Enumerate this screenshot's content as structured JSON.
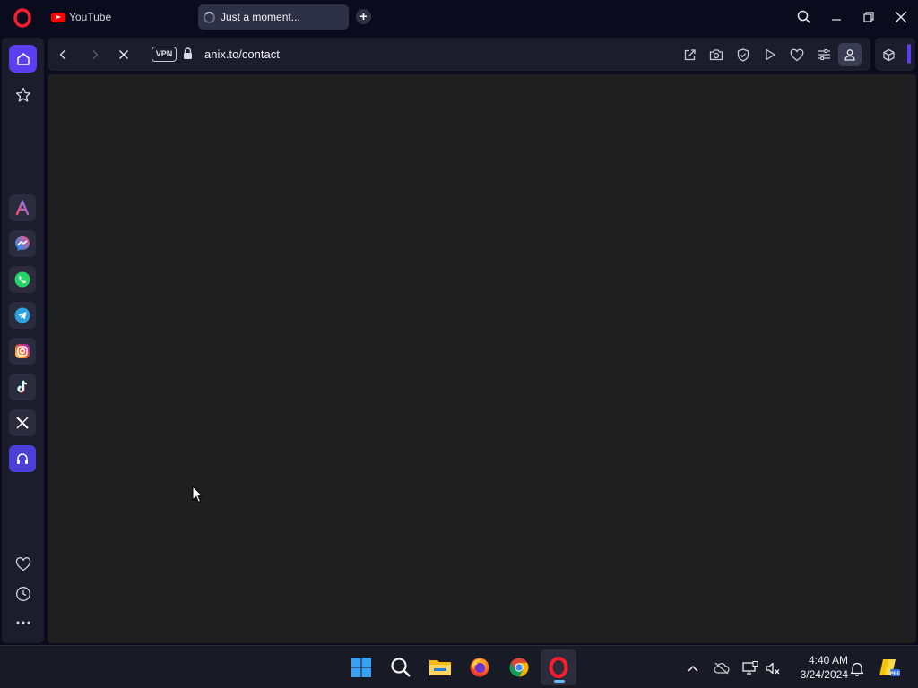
{
  "tabs": [
    {
      "title": "YouTube",
      "icon": "youtube-icon"
    },
    {
      "title": "Just a moment...",
      "icon": "loading-spinner-icon",
      "active": true
    }
  ],
  "address_bar": {
    "vpn_label": "VPN",
    "url": "anix.to/contact"
  },
  "sidebar": {
    "items": [
      "home-icon",
      "star-icon",
      "aria-icon",
      "messenger-icon",
      "whatsapp-icon",
      "telegram-icon",
      "instagram-icon",
      "tiktok-icon",
      "x-icon",
      "music-player-icon",
      "heart-icon",
      "history-icon",
      "more-icon"
    ]
  },
  "taskbar": {
    "time": "4:40 AM",
    "date": "3/24/2024"
  },
  "colors": {
    "accent": "#5b3ef0",
    "page_background": "#1f1f1f",
    "chrome_background": "#0a0b1c"
  }
}
